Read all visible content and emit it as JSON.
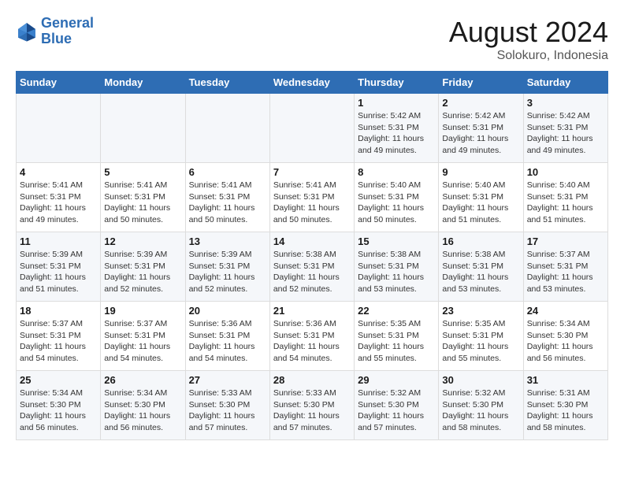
{
  "header": {
    "logo_line1": "General",
    "logo_line2": "Blue",
    "month_title": "August 2024",
    "subtitle": "Solokuro, Indonesia"
  },
  "weekdays": [
    "Sunday",
    "Monday",
    "Tuesday",
    "Wednesday",
    "Thursday",
    "Friday",
    "Saturday"
  ],
  "weeks": [
    [
      {
        "day": "",
        "info": ""
      },
      {
        "day": "",
        "info": ""
      },
      {
        "day": "",
        "info": ""
      },
      {
        "day": "",
        "info": ""
      },
      {
        "day": "1",
        "info": "Sunrise: 5:42 AM\nSunset: 5:31 PM\nDaylight: 11 hours\nand 49 minutes."
      },
      {
        "day": "2",
        "info": "Sunrise: 5:42 AM\nSunset: 5:31 PM\nDaylight: 11 hours\nand 49 minutes."
      },
      {
        "day": "3",
        "info": "Sunrise: 5:42 AM\nSunset: 5:31 PM\nDaylight: 11 hours\nand 49 minutes."
      }
    ],
    [
      {
        "day": "4",
        "info": "Sunrise: 5:41 AM\nSunset: 5:31 PM\nDaylight: 11 hours\nand 49 minutes."
      },
      {
        "day": "5",
        "info": "Sunrise: 5:41 AM\nSunset: 5:31 PM\nDaylight: 11 hours\nand 50 minutes."
      },
      {
        "day": "6",
        "info": "Sunrise: 5:41 AM\nSunset: 5:31 PM\nDaylight: 11 hours\nand 50 minutes."
      },
      {
        "day": "7",
        "info": "Sunrise: 5:41 AM\nSunset: 5:31 PM\nDaylight: 11 hours\nand 50 minutes."
      },
      {
        "day": "8",
        "info": "Sunrise: 5:40 AM\nSunset: 5:31 PM\nDaylight: 11 hours\nand 50 minutes."
      },
      {
        "day": "9",
        "info": "Sunrise: 5:40 AM\nSunset: 5:31 PM\nDaylight: 11 hours\nand 51 minutes."
      },
      {
        "day": "10",
        "info": "Sunrise: 5:40 AM\nSunset: 5:31 PM\nDaylight: 11 hours\nand 51 minutes."
      }
    ],
    [
      {
        "day": "11",
        "info": "Sunrise: 5:39 AM\nSunset: 5:31 PM\nDaylight: 11 hours\nand 51 minutes."
      },
      {
        "day": "12",
        "info": "Sunrise: 5:39 AM\nSunset: 5:31 PM\nDaylight: 11 hours\nand 52 minutes."
      },
      {
        "day": "13",
        "info": "Sunrise: 5:39 AM\nSunset: 5:31 PM\nDaylight: 11 hours\nand 52 minutes."
      },
      {
        "day": "14",
        "info": "Sunrise: 5:38 AM\nSunset: 5:31 PM\nDaylight: 11 hours\nand 52 minutes."
      },
      {
        "day": "15",
        "info": "Sunrise: 5:38 AM\nSunset: 5:31 PM\nDaylight: 11 hours\nand 53 minutes."
      },
      {
        "day": "16",
        "info": "Sunrise: 5:38 AM\nSunset: 5:31 PM\nDaylight: 11 hours\nand 53 minutes."
      },
      {
        "day": "17",
        "info": "Sunrise: 5:37 AM\nSunset: 5:31 PM\nDaylight: 11 hours\nand 53 minutes."
      }
    ],
    [
      {
        "day": "18",
        "info": "Sunrise: 5:37 AM\nSunset: 5:31 PM\nDaylight: 11 hours\nand 54 minutes."
      },
      {
        "day": "19",
        "info": "Sunrise: 5:37 AM\nSunset: 5:31 PM\nDaylight: 11 hours\nand 54 minutes."
      },
      {
        "day": "20",
        "info": "Sunrise: 5:36 AM\nSunset: 5:31 PM\nDaylight: 11 hours\nand 54 minutes."
      },
      {
        "day": "21",
        "info": "Sunrise: 5:36 AM\nSunset: 5:31 PM\nDaylight: 11 hours\nand 54 minutes."
      },
      {
        "day": "22",
        "info": "Sunrise: 5:35 AM\nSunset: 5:31 PM\nDaylight: 11 hours\nand 55 minutes."
      },
      {
        "day": "23",
        "info": "Sunrise: 5:35 AM\nSunset: 5:31 PM\nDaylight: 11 hours\nand 55 minutes."
      },
      {
        "day": "24",
        "info": "Sunrise: 5:34 AM\nSunset: 5:30 PM\nDaylight: 11 hours\nand 56 minutes."
      }
    ],
    [
      {
        "day": "25",
        "info": "Sunrise: 5:34 AM\nSunset: 5:30 PM\nDaylight: 11 hours\nand 56 minutes."
      },
      {
        "day": "26",
        "info": "Sunrise: 5:34 AM\nSunset: 5:30 PM\nDaylight: 11 hours\nand 56 minutes."
      },
      {
        "day": "27",
        "info": "Sunrise: 5:33 AM\nSunset: 5:30 PM\nDaylight: 11 hours\nand 57 minutes."
      },
      {
        "day": "28",
        "info": "Sunrise: 5:33 AM\nSunset: 5:30 PM\nDaylight: 11 hours\nand 57 minutes."
      },
      {
        "day": "29",
        "info": "Sunrise: 5:32 AM\nSunset: 5:30 PM\nDaylight: 11 hours\nand 57 minutes."
      },
      {
        "day": "30",
        "info": "Sunrise: 5:32 AM\nSunset: 5:30 PM\nDaylight: 11 hours\nand 58 minutes."
      },
      {
        "day": "31",
        "info": "Sunrise: 5:31 AM\nSunset: 5:30 PM\nDaylight: 11 hours\nand 58 minutes."
      }
    ]
  ]
}
